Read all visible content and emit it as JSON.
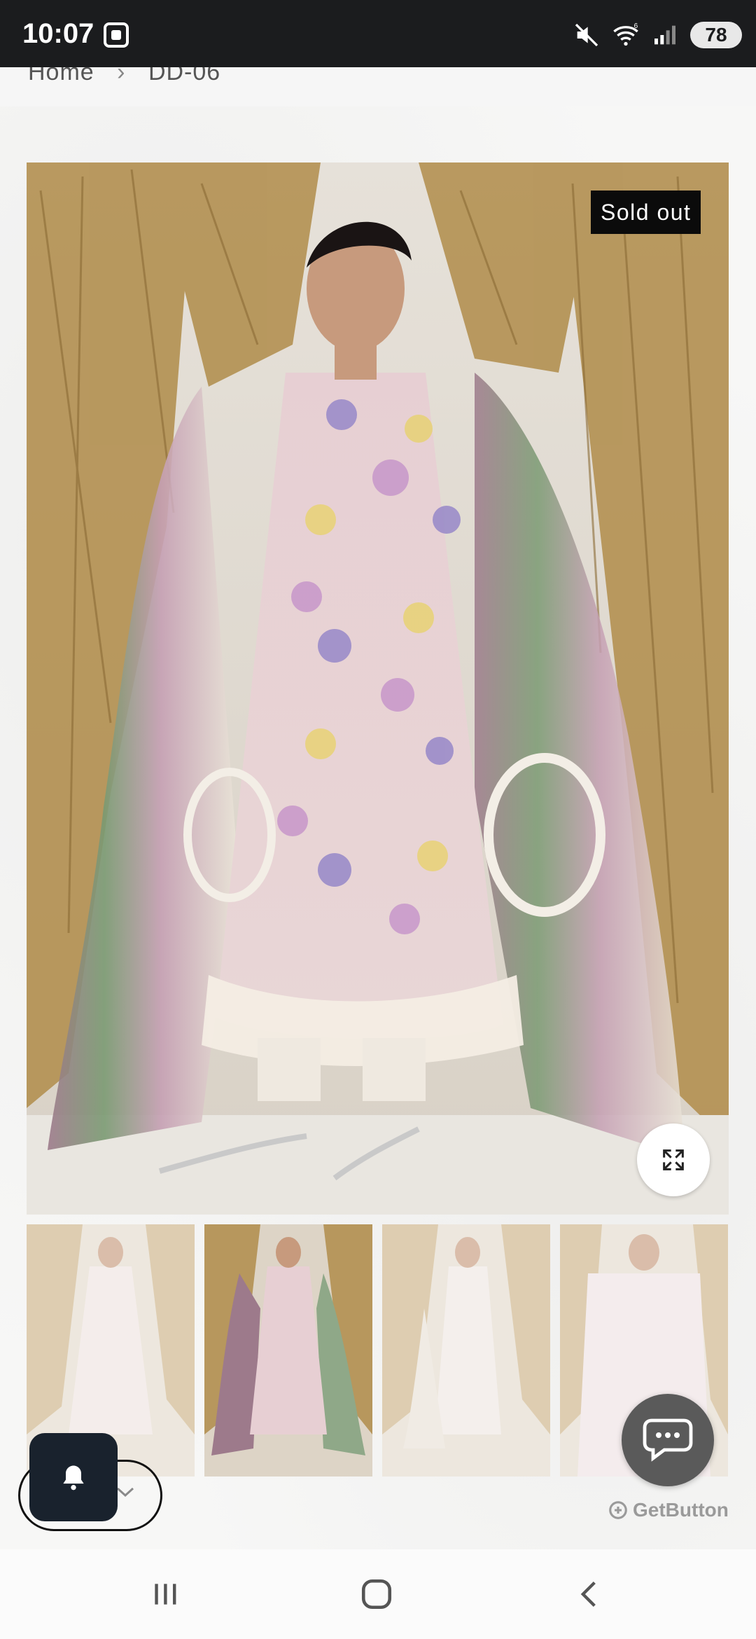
{
  "status_bar": {
    "time": "10:07",
    "battery": "78",
    "wifi_label": "6"
  },
  "breadcrumb": {
    "home": "Home",
    "separator": "›",
    "current": "DD-06"
  },
  "product": {
    "badge": "Sold out"
  },
  "thumbnails": [
    {
      "label": "product-thumbnail-1"
    },
    {
      "label": "product-thumbnail-2"
    },
    {
      "label": "product-thumbnail-3"
    },
    {
      "label": "product-thumbnail-4"
    }
  ],
  "widgets": {
    "getbutton_label": "GetButton"
  },
  "colors": {
    "status_bar": "#1b1c1e",
    "badge_bg": "#0b0b0b",
    "chat_bg": "#5a5a5a",
    "bell_bg": "#19222d"
  }
}
